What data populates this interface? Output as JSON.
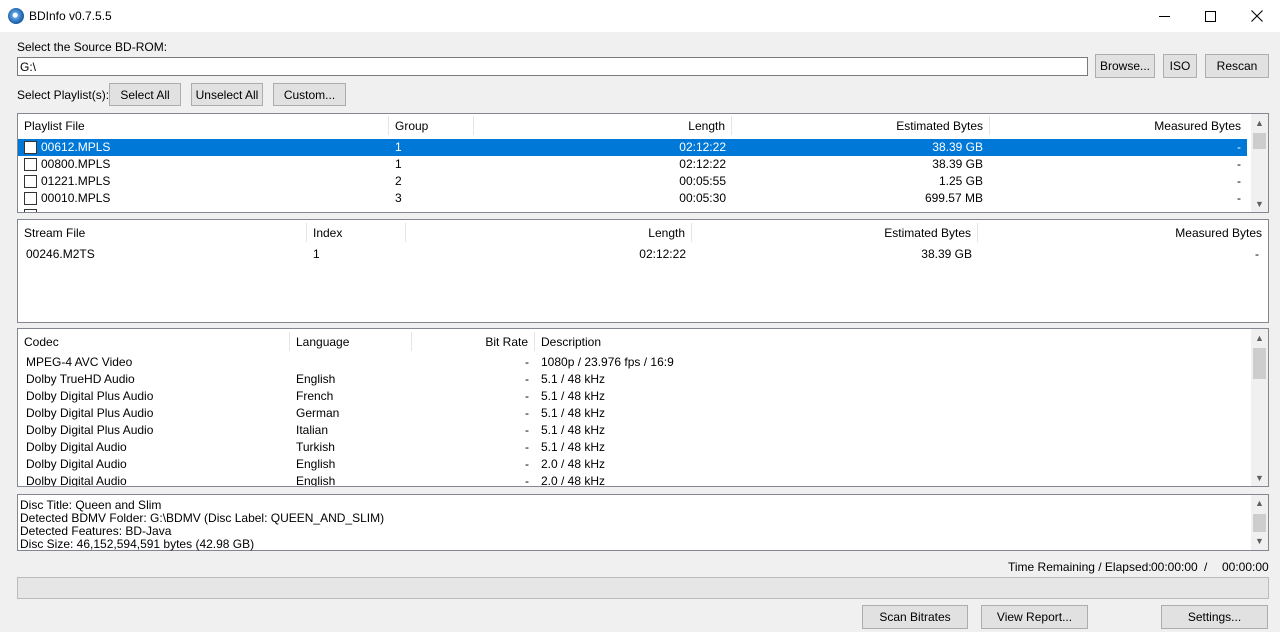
{
  "window": {
    "title": "BDInfo v0.7.5.5",
    "icon": "disc-icon",
    "controls": [
      "minimize-icon",
      "maximize-icon",
      "close-icon"
    ]
  },
  "source": {
    "label": "Select the Source BD-ROM:",
    "path": "G:\\",
    "browse_label": "Browse...",
    "iso_label": "ISO",
    "rescan_label": "Rescan"
  },
  "playlist_controls": {
    "label": "Select Playlist(s):",
    "select_all": "Select All",
    "unselect_all": "Unselect All",
    "custom": "Custom..."
  },
  "playlists": {
    "columns": [
      "Playlist File",
      "Group",
      "Length",
      "Estimated Bytes",
      "Measured Bytes"
    ],
    "rows": [
      {
        "file": "00612.MPLS",
        "group": "1",
        "length": "02:12:22",
        "est": "38.39 GB",
        "measured": "-",
        "selected": true
      },
      {
        "file": "00800.MPLS",
        "group": "1",
        "length": "02:12:22",
        "est": "38.39 GB",
        "measured": "-"
      },
      {
        "file": "01221.MPLS",
        "group": "2",
        "length": "00:05:55",
        "est": "1.25 GB",
        "measured": "-"
      },
      {
        "file": "00010.MPLS",
        "group": "3",
        "length": "00:05:30",
        "est": "699.57 MB",
        "measured": "-"
      }
    ]
  },
  "streams": {
    "columns": [
      "Stream File",
      "Index",
      "Length",
      "Estimated Bytes",
      "Measured Bytes"
    ],
    "rows": [
      {
        "file": "00246.M2TS",
        "index": "1",
        "length": "02:12:22",
        "est": "38.39 GB",
        "measured": "-"
      }
    ]
  },
  "codecs": {
    "columns": [
      "Codec",
      "Language",
      "Bit Rate",
      "Description"
    ],
    "rows": [
      {
        "codec": "MPEG-4 AVC Video",
        "language": "",
        "bitrate": "-",
        "desc": "1080p / 23.976 fps / 16:9"
      },
      {
        "codec": "Dolby TrueHD Audio",
        "language": "English",
        "bitrate": "-",
        "desc": "5.1 / 48 kHz"
      },
      {
        "codec": "Dolby Digital Plus Audio",
        "language": "French",
        "bitrate": "-",
        "desc": "5.1 / 48 kHz"
      },
      {
        "codec": "Dolby Digital Plus Audio",
        "language": "German",
        "bitrate": "-",
        "desc": "5.1 / 48 kHz"
      },
      {
        "codec": "Dolby Digital Plus Audio",
        "language": "Italian",
        "bitrate": "-",
        "desc": "5.1 / 48 kHz"
      },
      {
        "codec": "Dolby Digital Audio",
        "language": "Turkish",
        "bitrate": "-",
        "desc": "5.1 / 48 kHz"
      },
      {
        "codec": "Dolby Digital Audio",
        "language": "English",
        "bitrate": "-",
        "desc": "2.0 / 48 kHz"
      },
      {
        "codec": "Dolby Digital Audio",
        "language": "English",
        "bitrate": "-",
        "desc": "2.0 / 48 kHz"
      }
    ]
  },
  "report": {
    "lines": [
      "Disc Title: Queen and Slim",
      "Detected BDMV Folder: G:\\BDMV (Disc Label: QUEEN_AND_SLIM)",
      "Detected Features: BD-Java",
      "Disc Size: 46,152,594,591 bytes (42.98 GB)"
    ]
  },
  "status": {
    "time_label": "Time Remaining / Elapsed:",
    "remaining": "00:00:00",
    "separator": "/",
    "elapsed": "00:00:00",
    "progress": 0
  },
  "actions": {
    "scan": "Scan Bitrates",
    "report": "View Report...",
    "settings": "Settings..."
  }
}
